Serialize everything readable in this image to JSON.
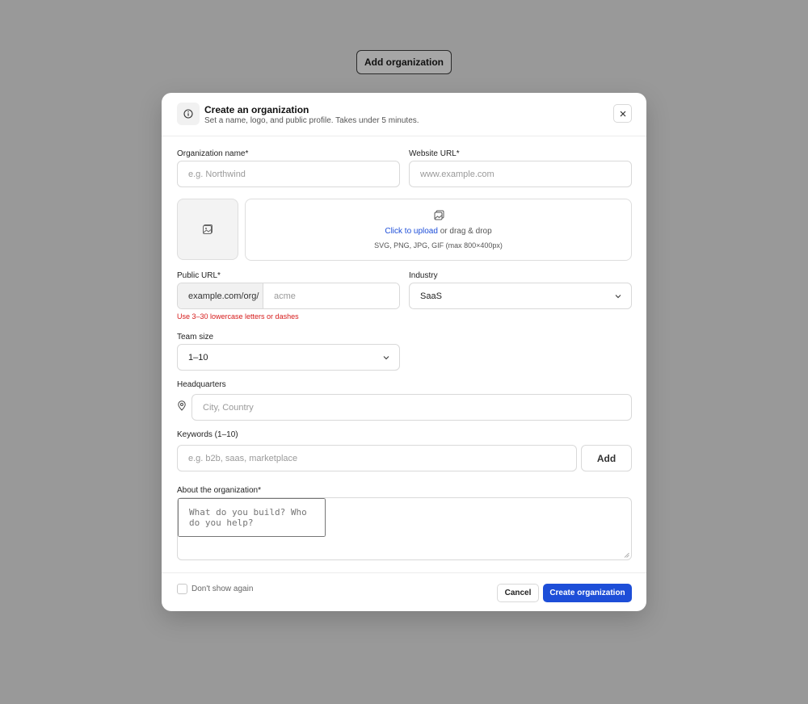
{
  "trigger": {
    "label": "Add organization"
  },
  "modal": {
    "title": "Create an organization",
    "subtitle": "Set a name, logo, and public profile. Takes under 5 minutes.",
    "info_icon": "info-icon",
    "close_icon": "close-icon"
  },
  "form": {
    "org_name": {
      "label": "Organization name*",
      "placeholder": "e.g. Northwind",
      "value": ""
    },
    "website": {
      "label": "Website URL*",
      "placeholder": "www.example.com",
      "value": ""
    },
    "logo": {
      "placeholder_icon": "image-icon",
      "upload_icon": "upload-images-icon",
      "upload_link": "Click to upload",
      "upload_rest": " or drag & drop",
      "hint": "SVG, PNG, JPG, GIF (max 800×400px)"
    },
    "public_url": {
      "label": "Public URL*",
      "prefix": "example.com/org/",
      "placeholder": "acme",
      "value": "",
      "error": "Use 3–30 lowercase letters or dashes"
    },
    "industry": {
      "label": "Industry",
      "value": "SaaS"
    },
    "team_size": {
      "label": "Team size",
      "value": "1–10"
    },
    "headquarters": {
      "label": "Headquarters",
      "placeholder": "City, Country",
      "value": "",
      "icon": "location-pin-icon"
    },
    "keywords": {
      "label": "Keywords (1–10)",
      "placeholder": "e.g. b2b, saas, marketplace",
      "value": "",
      "add_label": "Add"
    },
    "about": {
      "label": "About the organization*",
      "placeholder": "What do you build? Who do you help?",
      "value": ""
    }
  },
  "footer": {
    "dont_show_label": "Don't show again",
    "dont_show_checked": false,
    "cancel_label": "Cancel",
    "create_label": "Create organization"
  },
  "colors": {
    "backdrop": "#999999",
    "primary": "#1d4ed8",
    "error": "#d61a1a",
    "link": "#1d4ed8"
  }
}
